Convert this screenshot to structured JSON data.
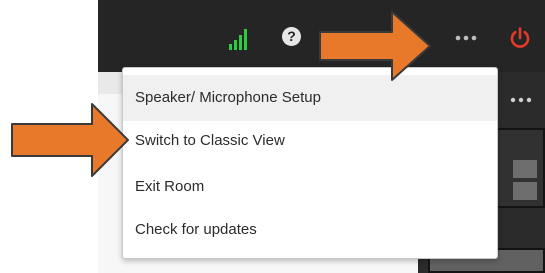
{
  "topbar": {
    "help_glyph": "?",
    "icons": [
      "signal-strength-icon",
      "help-icon",
      "more-options-icon",
      "power-icon"
    ]
  },
  "menu": {
    "items": [
      {
        "label": "Speaker/ Microphone Setup"
      },
      {
        "label": "Switch to Classic View"
      },
      {
        "label": "Exit Room"
      },
      {
        "label": "Check for updates"
      }
    ],
    "highlighted_index": 0
  },
  "colors": {
    "topbar_bg": "#252525",
    "signal_green": "#2ecc40",
    "power_red": "#e5392a",
    "annotation_arrow_orange": "#e8782a",
    "menu_bg": "#ffffff",
    "menu_highlight": "#f0f0f0"
  }
}
